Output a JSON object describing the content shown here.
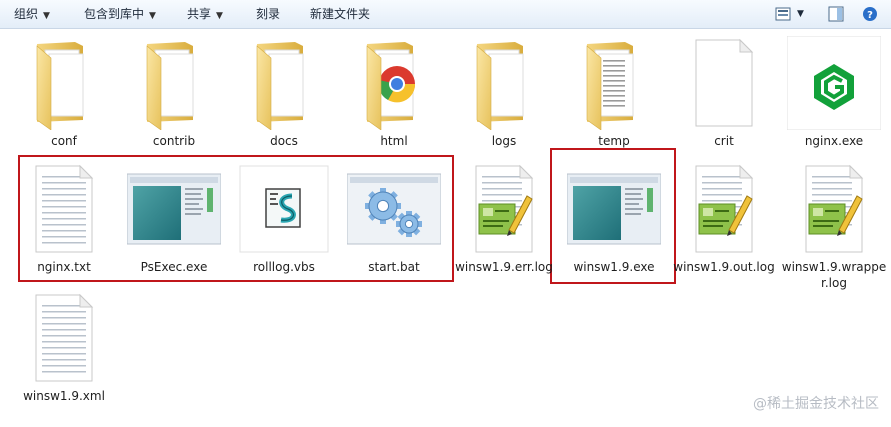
{
  "toolbar": {
    "organize": "组织",
    "include_in_library": "包含到库中",
    "share": "共享",
    "burn": "刻录",
    "new_folder": "新建文件夹"
  },
  "files": [
    {
      "name": "conf",
      "type": "folder"
    },
    {
      "name": "contrib",
      "type": "folder"
    },
    {
      "name": "docs",
      "type": "folder"
    },
    {
      "name": "html",
      "type": "folder-chrome"
    },
    {
      "name": "logs",
      "type": "folder"
    },
    {
      "name": "temp",
      "type": "folder-docs"
    },
    {
      "name": "crit",
      "type": "blank"
    },
    {
      "name": "nginx.exe",
      "type": "nginx"
    },
    {
      "name": "nginx.txt",
      "type": "text"
    },
    {
      "name": "PsExec.exe",
      "type": "app"
    },
    {
      "name": "rolllog.vbs",
      "type": "vbs"
    },
    {
      "name": "start.bat",
      "type": "bat"
    },
    {
      "name": "winsw1.9.err.log",
      "type": "log"
    },
    {
      "name": "winsw1.9.exe",
      "type": "app"
    },
    {
      "name": "winsw1.9.out.log",
      "type": "log"
    },
    {
      "name": "winsw1.9.wrapper.log",
      "type": "log"
    },
    {
      "name": "winsw1.9.xml",
      "type": "text"
    }
  ],
  "highlight_color": "#c0161b",
  "watermark": "@稀土掘金技术社区"
}
